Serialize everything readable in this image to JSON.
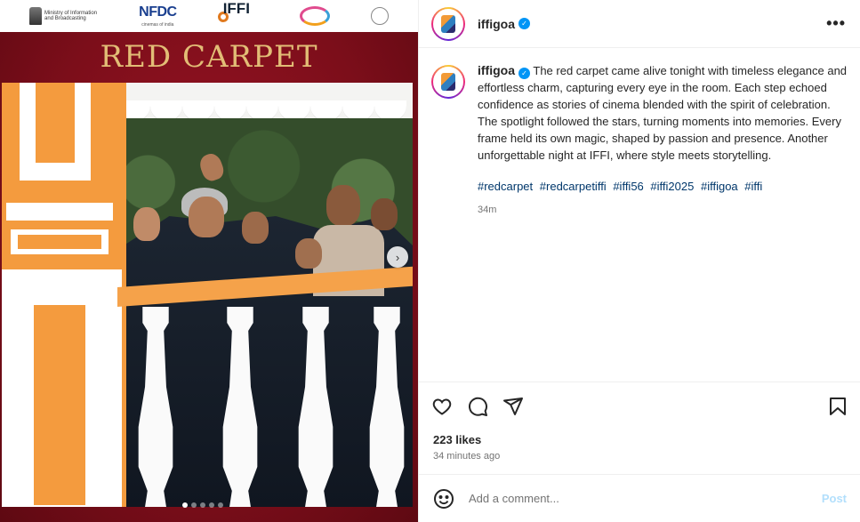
{
  "media": {
    "logos": {
      "ministry": "Ministry of Information and Broadcasting",
      "nfdc_main": "NFDC",
      "nfdc_sub": "cinemas of india",
      "iffi": "IFFI"
    },
    "title": "RED CARPET",
    "carousel": {
      "total": 5,
      "active": 0
    },
    "next_icon": "chevron-right-icon"
  },
  "header": {
    "username": "iffigoa",
    "verified_icon": "verified-badge-icon",
    "more_icon": "more-horizontal-icon"
  },
  "caption": {
    "username": "iffigoa",
    "text": "The red carpet came alive tonight with timeless elegance and effortless charm, capturing every eye in the room. Each step echoed confidence as stories of cinema blended with the spirit of celebration. The spotlight followed the stars, turning moments into memories. Every frame held its own magic, shaped by passion and presence. Another unforgettable night at IFFI, where style meets storytelling.",
    "hashtags": [
      "#redcarpet",
      "#redcarpetiffi",
      "#iffi56",
      "#iffi2025",
      "#iffigoa",
      "#iffi"
    ],
    "age": "34m"
  },
  "actions": {
    "icons": [
      "heart-icon",
      "comment-icon",
      "share-icon",
      "bookmark-icon"
    ],
    "likes": "223 likes",
    "time": "34 minutes ago"
  },
  "comment": {
    "emoji_icon": "emoji-icon",
    "placeholder": "Add a comment...",
    "post_label": "Post"
  },
  "colors": {
    "link": "#00376b",
    "post_disabled": "#b2dffc",
    "verified": "#0095f6",
    "carpet_red": "#7d0f1a",
    "title_gold": "#e2bd76"
  }
}
